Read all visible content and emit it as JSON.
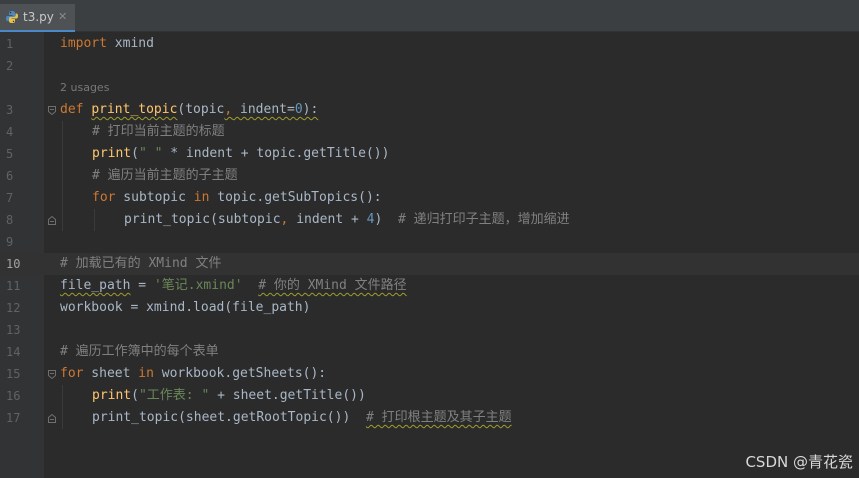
{
  "tab": {
    "file_icon": "python-file-icon",
    "label": "t3.py",
    "close_glyph": "✕"
  },
  "editor": {
    "line_numbers": [
      "1",
      "2",
      "3",
      "4",
      "5",
      "6",
      "7",
      "8",
      "9",
      "10",
      "11",
      "12",
      "13",
      "14",
      "15",
      "16",
      "17"
    ],
    "current_line": "10",
    "inlay_hint": "2 usages",
    "code": {
      "l1": {
        "import": "import",
        "module": " xmind"
      },
      "l3": {
        "def": "def",
        "space": " ",
        "name": "print_topic",
        "open": "(topic",
        "comma": ",",
        "indent_param": " indent=",
        "default": "0",
        "close": "):"
      },
      "l4": {
        "comment": "# 打印当前主题的标题"
      },
      "l5": {
        "print": "print",
        "open": "(",
        "string": "\" \"",
        "rest": " * indent + topic.getTitle())"
      },
      "l6": {
        "comment": "# 遍历当前主题的子主题"
      },
      "l7": {
        "for": "for",
        "var": " subtopic ",
        "in": "in",
        "rest": " topic.getSubTopics():"
      },
      "l8": {
        "call": "print_topic(subtopic",
        "comma": ",",
        "rest": " indent + ",
        "num": "4",
        "close": ")  ",
        "comment": "# 递归打印子主题，增加缩进"
      },
      "l10": {
        "comment": "# 加载已有的 XMind 文件"
      },
      "l11": {
        "var": "file_path",
        "eq": " = ",
        "string": "'笔记.xmind'",
        "gap": "  ",
        "comment": "# 你的 XMind 文件路径"
      },
      "l12": {
        "text": "workbook = xmind.load(file_path)"
      },
      "l14": {
        "comment": "# 遍历工作簿中的每个表单"
      },
      "l15": {
        "for": "for",
        "var": " sheet ",
        "in": "in",
        "rest": " workbook.getSheets():"
      },
      "l16": {
        "print": "print",
        "open": "(",
        "string": "\"工作表: \"",
        "rest": " + sheet.getTitle())"
      },
      "l17": {
        "call": "print_topic(sheet.getRootTopic())",
        "gap": "  ",
        "comment": "# 打印根主题及其子主题"
      }
    }
  },
  "watermark": "CSDN @青花瓷",
  "colors": {
    "background": "#2b2b2b",
    "keyword": "#cc7832",
    "function": "#ffc66d",
    "string": "#6a8759",
    "number": "#6897bb",
    "comment": "#808080"
  }
}
